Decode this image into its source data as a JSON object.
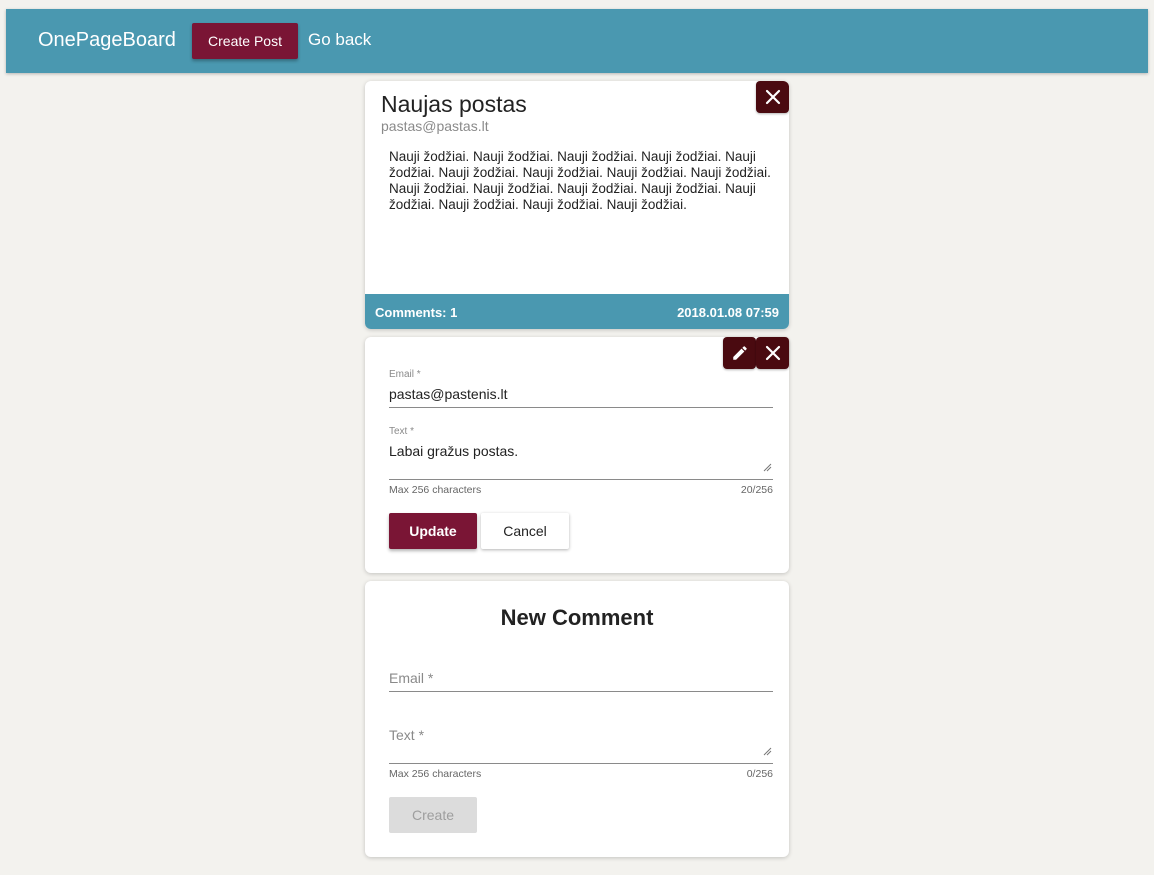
{
  "navbar": {
    "brand": "OnePageBoard",
    "create_post_label": "Create Post",
    "go_back_label": "Go back"
  },
  "post": {
    "title": "Naujas postas",
    "email": "pastas@pastas.lt",
    "body": "Nauji žodžiai. Nauji žodžiai. Nauji žodžiai. Nauji žodžiai. Nauji žodžiai. Nauji žodžiai. Nauji žodžiai. Nauji žodžiai. Nauji žodžiai. Nauji žodžiai. Nauji žodžiai. Nauji žodžiai. Nauji žodžiai. Nauji žodžiai. Nauji žodžiai. Nauji žodžiai. Nauji žodžiai.",
    "comments_label": "Comments:",
    "comments_count": "1",
    "date": "2018.01.08 07:59"
  },
  "edit_comment": {
    "email_label": "Email *",
    "email_value": "pastas@pastenis.lt",
    "text_label": "Text *",
    "text_value": "Labai gražus postas.",
    "hint": "Max 256 characters",
    "counter": "20/256",
    "update_label": "Update",
    "cancel_label": "Cancel"
  },
  "new_comment": {
    "title": "New Comment",
    "email_placeholder": "Email *",
    "text_placeholder": "Text *",
    "hint": "Max 256 characters",
    "counter": "0/256",
    "create_label": "Create"
  },
  "icons": {
    "close": "close-icon",
    "edit": "pencil-icon"
  },
  "colors": {
    "navbar": "#4a98b0",
    "primary": "#7a1535",
    "icon_button": "#4a0a10",
    "background": "#f3f2ee"
  }
}
